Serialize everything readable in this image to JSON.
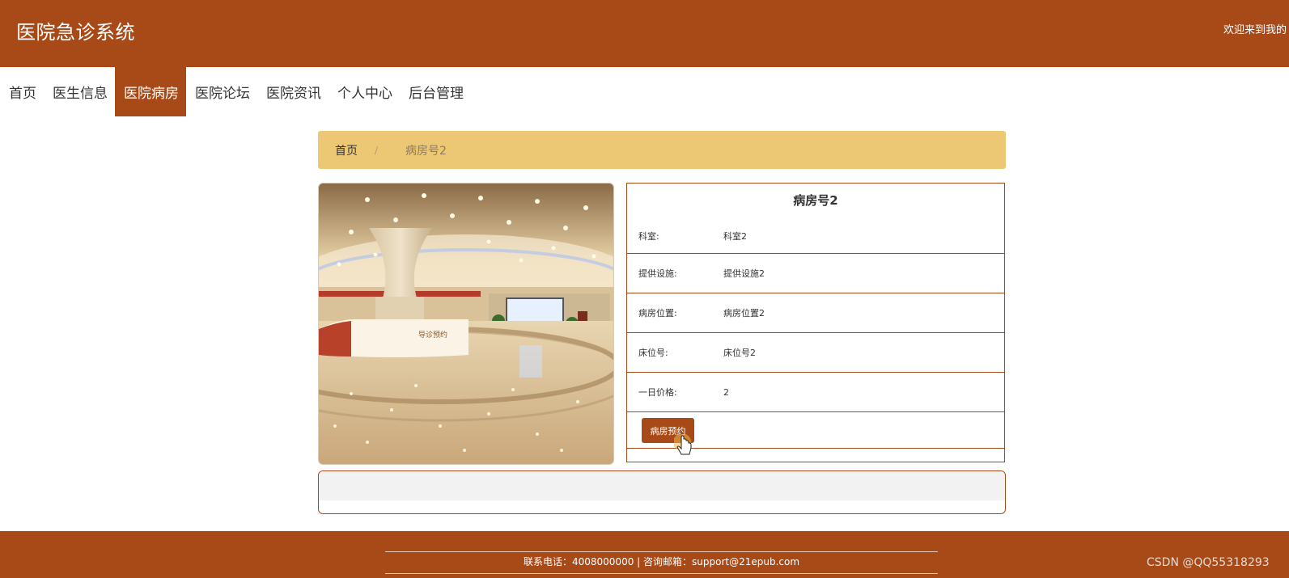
{
  "header": {
    "title": "医院急诊系统",
    "welcome": "欢迎来到我的"
  },
  "nav": {
    "items": [
      {
        "label": "首页"
      },
      {
        "label": "医生信息"
      },
      {
        "label": "医院病房"
      },
      {
        "label": "医院论坛"
      },
      {
        "label": "医院资讯"
      },
      {
        "label": "个人中心"
      },
      {
        "label": "后台管理"
      }
    ],
    "active": "医院病房"
  },
  "breadcrumb": {
    "home": "首页",
    "separator": "/",
    "current": "病房号2"
  },
  "detail": {
    "title": "病房号2",
    "fields": [
      {
        "label": "科室:",
        "value": "科室2"
      },
      {
        "label": "提供设施:",
        "value": "提供设施2"
      },
      {
        "label": "病房位置:",
        "value": "病房位置2"
      },
      {
        "label": "床位号:",
        "value": "床位号2"
      },
      {
        "label": "一日价格:",
        "value": "2"
      }
    ],
    "book_button": "病房预约"
  },
  "photo": {
    "sign_text": "导诊预约"
  },
  "footer": {
    "contact": "联系电话：4008000000 | 咨询邮箱：support@21epub.com"
  },
  "watermark": "CSDN @QQ55318293",
  "colors": {
    "primary": "#a84a18",
    "breadcrumb_bg": "#edc874",
    "white": "#ffffff"
  }
}
